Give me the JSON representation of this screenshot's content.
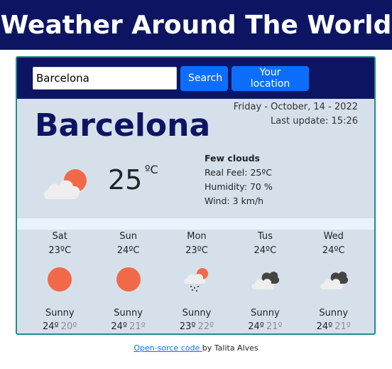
{
  "header": {
    "title": "Weather Around The World"
  },
  "search": {
    "value": "Barcelona",
    "search_label": "Search",
    "location_label": "Your location"
  },
  "current": {
    "date": "Friday - October, 14 - 2022",
    "last_update": "Last update: 15:26",
    "city": "Barcelona",
    "temperature": "25",
    "unit": "ºC",
    "icon": "few-clouds-icon",
    "description": "Few clouds",
    "real_feel": "Real Feel: 25ºC",
    "humidity": "Humidity: 70 %",
    "wind": "Wind: 3 km/h"
  },
  "forecast": [
    {
      "day": "Sat",
      "temp": "23ºC",
      "icon": "sun-icon",
      "desc": "Sunny",
      "max": "24º",
      "min": "20º"
    },
    {
      "day": "Sun",
      "temp": "24ºC",
      "icon": "sun-icon",
      "desc": "Sunny",
      "max": "24º",
      "min": "21º"
    },
    {
      "day": "Mon",
      "temp": "23ºC",
      "icon": "rain-cloud-icon",
      "desc": "Sunny",
      "max": "23º",
      "min": "22º"
    },
    {
      "day": "Tus",
      "temp": "24ºC",
      "icon": "broken-clouds-icon",
      "desc": "Sunny",
      "max": "24º",
      "min": "21º"
    },
    {
      "day": "Wed",
      "temp": "24ºC",
      "icon": "broken-clouds-icon",
      "desc": "Sunny",
      "max": "24º",
      "min": "21º"
    }
  ],
  "footer": {
    "link_text": "Open-sorce code ",
    "author_text": "by Talita Alves"
  },
  "colors": {
    "banner": "#0d1563",
    "button": "#0d6efd",
    "card_border": "#1c8f88",
    "card_bg": "#d6e0ea",
    "sun": "#f06a4a"
  }
}
